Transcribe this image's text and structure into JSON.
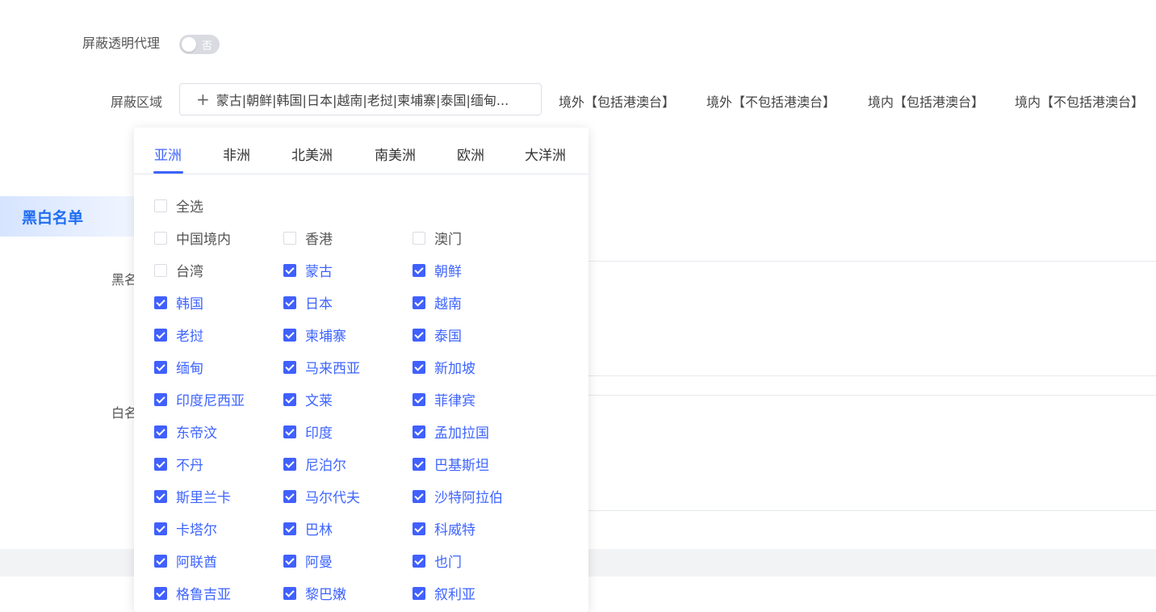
{
  "form": {
    "transparent_proxy": {
      "label": "屏蔽透明代理",
      "toggle_text": "否"
    },
    "region": {
      "label": "屏蔽区域",
      "plus": "+",
      "value": "蒙古|朝鲜|韩国|日本|越南|老挝|柬埔寨|泰国|缅甸...",
      "quick_links": [
        "境外【包括港澳台】",
        "境外【不包括港澳台】",
        "境内【包括港澳台】",
        "境内【不包括港澳台】"
      ]
    }
  },
  "section": {
    "title": "黑白名单"
  },
  "list_labels": {
    "black": "黑名",
    "white": "白名"
  },
  "popup": {
    "tabs": [
      "亚洲",
      "非洲",
      "北美洲",
      "南美洲",
      "欧洲",
      "大洋洲"
    ],
    "active_tab": "亚洲",
    "select_all": {
      "label": "全选",
      "checked": false
    },
    "options": [
      {
        "label": "中国境内",
        "checked": false
      },
      {
        "label": "香港",
        "checked": false
      },
      {
        "label": "澳门",
        "checked": false
      },
      {
        "label": "台湾",
        "checked": false
      },
      {
        "label": "蒙古",
        "checked": true
      },
      {
        "label": "朝鲜",
        "checked": true
      },
      {
        "label": "韩国",
        "checked": true
      },
      {
        "label": "日本",
        "checked": true
      },
      {
        "label": "越南",
        "checked": true
      },
      {
        "label": "老挝",
        "checked": true
      },
      {
        "label": "柬埔寨",
        "checked": true
      },
      {
        "label": "泰国",
        "checked": true
      },
      {
        "label": "缅甸",
        "checked": true
      },
      {
        "label": "马来西亚",
        "checked": true
      },
      {
        "label": "新加坡",
        "checked": true
      },
      {
        "label": "印度尼西亚",
        "checked": true
      },
      {
        "label": "文莱",
        "checked": true
      },
      {
        "label": "菲律宾",
        "checked": true
      },
      {
        "label": "东帝汶",
        "checked": true
      },
      {
        "label": "印度",
        "checked": true
      },
      {
        "label": "孟加拉国",
        "checked": true
      },
      {
        "label": "不丹",
        "checked": true
      },
      {
        "label": "尼泊尔",
        "checked": true
      },
      {
        "label": "巴基斯坦",
        "checked": true
      },
      {
        "label": "斯里兰卡",
        "checked": true
      },
      {
        "label": "马尔代夫",
        "checked": true
      },
      {
        "label": "沙特阿拉伯",
        "checked": true
      },
      {
        "label": "卡塔尔",
        "checked": true
      },
      {
        "label": "巴林",
        "checked": true
      },
      {
        "label": "科威特",
        "checked": true
      },
      {
        "label": "阿联酋",
        "checked": true
      },
      {
        "label": "阿曼",
        "checked": true
      },
      {
        "label": "也门",
        "checked": true
      },
      {
        "label": "格鲁吉亚",
        "checked": true
      },
      {
        "label": "黎巴嫩",
        "checked": true
      },
      {
        "label": "叙利亚",
        "checked": true
      }
    ]
  },
  "colors": {
    "accent": "#3e64ff",
    "section_text": "#1f6df2"
  }
}
